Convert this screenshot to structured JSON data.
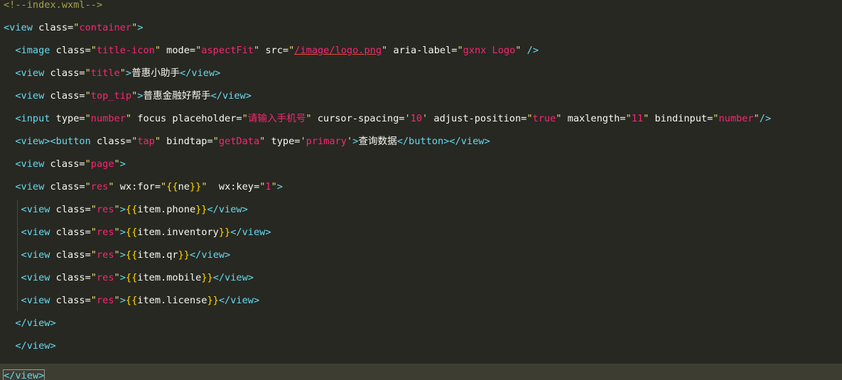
{
  "editor": {
    "language": "wxml",
    "current_line": 16,
    "lines": [
      [
        {
          "t": "<!--index.wxml-->",
          "c": "comment"
        }
      ],
      [
        {
          "t": "<view ",
          "c": "tag"
        },
        {
          "t": "class=",
          "c": "attr"
        },
        {
          "t": "\"",
          "c": "str"
        },
        {
          "t": "container",
          "c": "str-red"
        },
        {
          "t": "\"",
          "c": "str"
        },
        {
          "t": ">",
          "c": "tag"
        }
      ],
      [
        {
          "t": "  <image ",
          "c": "tag"
        },
        {
          "t": "class=",
          "c": "attr"
        },
        {
          "t": "\"",
          "c": "str"
        },
        {
          "t": "title-icon",
          "c": "str-red"
        },
        {
          "t": "\"",
          "c": "str"
        },
        {
          "t": " mode=",
          "c": "attr"
        },
        {
          "t": "\"",
          "c": "str"
        },
        {
          "t": "aspectFit",
          "c": "str-red"
        },
        {
          "t": "\"",
          "c": "str"
        },
        {
          "t": " src=",
          "c": "attr"
        },
        {
          "t": "\"",
          "c": "str"
        },
        {
          "t": "/image/logo.png",
          "c": "str-red",
          "link": true
        },
        {
          "t": "\"",
          "c": "str"
        },
        {
          "t": " aria-label=",
          "c": "attr"
        },
        {
          "t": "\"",
          "c": "str"
        },
        {
          "t": "gxnx Logo",
          "c": "str-red"
        },
        {
          "t": "\"",
          "c": "str"
        },
        {
          "t": " />",
          "c": "tag"
        }
      ],
      [
        {
          "t": "  <view ",
          "c": "tag"
        },
        {
          "t": "class=",
          "c": "attr"
        },
        {
          "t": "\"",
          "c": "str"
        },
        {
          "t": "title",
          "c": "str-red"
        },
        {
          "t": "\"",
          "c": "str"
        },
        {
          "t": ">",
          "c": "tag"
        },
        {
          "t": "普惠小助手",
          "c": "text"
        },
        {
          "t": "</view>",
          "c": "tag"
        }
      ],
      [
        {
          "t": "  <view ",
          "c": "tag"
        },
        {
          "t": "class=",
          "c": "attr"
        },
        {
          "t": "\"",
          "c": "str"
        },
        {
          "t": "top_tip",
          "c": "str-red"
        },
        {
          "t": "\"",
          "c": "str"
        },
        {
          "t": ">",
          "c": "tag"
        },
        {
          "t": "普惠金融好帮手",
          "c": "text"
        },
        {
          "t": "</view>",
          "c": "tag"
        }
      ],
      [
        {
          "t": "  <input ",
          "c": "tag"
        },
        {
          "t": "type=",
          "c": "attr"
        },
        {
          "t": "\"",
          "c": "str"
        },
        {
          "t": "number",
          "c": "str-red"
        },
        {
          "t": "\"",
          "c": "str"
        },
        {
          "t": " focus placeholder=",
          "c": "attr"
        },
        {
          "t": "\"",
          "c": "str"
        },
        {
          "t": "请输入手机号",
          "c": "str-red"
        },
        {
          "t": "\"",
          "c": "str"
        },
        {
          "t": " cursor-spacing=",
          "c": "attr"
        },
        {
          "t": "'",
          "c": "str"
        },
        {
          "t": "10",
          "c": "str-red"
        },
        {
          "t": "'",
          "c": "str"
        },
        {
          "t": " adjust-position=",
          "c": "attr"
        },
        {
          "t": "\"",
          "c": "str"
        },
        {
          "t": "true",
          "c": "str-red"
        },
        {
          "t": "\"",
          "c": "str"
        },
        {
          "t": " maxlength=",
          "c": "attr"
        },
        {
          "t": "\"",
          "c": "str"
        },
        {
          "t": "11",
          "c": "str-red"
        },
        {
          "t": "\"",
          "c": "str"
        },
        {
          "t": " bindinput=",
          "c": "attr"
        },
        {
          "t": "\"",
          "c": "str"
        },
        {
          "t": "number",
          "c": "str-red"
        },
        {
          "t": "\"",
          "c": "str"
        },
        {
          "t": "/>",
          "c": "tag"
        }
      ],
      [
        {
          "t": "  <view><button ",
          "c": "tag"
        },
        {
          "t": "class=",
          "c": "attr"
        },
        {
          "t": "\"",
          "c": "str"
        },
        {
          "t": "tap",
          "c": "str-red"
        },
        {
          "t": "\"",
          "c": "str"
        },
        {
          "t": " bindtap=",
          "c": "attr"
        },
        {
          "t": "\"",
          "c": "str"
        },
        {
          "t": "getData",
          "c": "str-red"
        },
        {
          "t": "\"",
          "c": "str"
        },
        {
          "t": " type=",
          "c": "attr"
        },
        {
          "t": "'",
          "c": "str"
        },
        {
          "t": "primary",
          "c": "str-red"
        },
        {
          "t": "'",
          "c": "str"
        },
        {
          "t": ">",
          "c": "tag"
        },
        {
          "t": "查询数据",
          "c": "text"
        },
        {
          "t": "</button></view>",
          "c": "tag"
        }
      ],
      [
        {
          "t": "  <view ",
          "c": "tag"
        },
        {
          "t": "class=",
          "c": "attr"
        },
        {
          "t": "\"",
          "c": "str"
        },
        {
          "t": "page",
          "c": "str-red"
        },
        {
          "t": "\"",
          "c": "str"
        },
        {
          "t": ">",
          "c": "tag"
        }
      ],
      [
        {
          "t": "  <view ",
          "c": "tag"
        },
        {
          "t": "class=",
          "c": "attr"
        },
        {
          "t": "\"",
          "c": "str"
        },
        {
          "t": "res",
          "c": "str-red"
        },
        {
          "t": "\"",
          "c": "str"
        },
        {
          "t": " wx:for=",
          "c": "attr"
        },
        {
          "t": "\"",
          "c": "str"
        },
        {
          "t": "{{",
          "c": "brace1"
        },
        {
          "t": "ne",
          "c": "text"
        },
        {
          "t": "}}",
          "c": "brace1"
        },
        {
          "t": "\"",
          "c": "str"
        },
        {
          "t": "  wx:key=",
          "c": "attr"
        },
        {
          "t": "\"",
          "c": "str"
        },
        {
          "t": "1",
          "c": "str-red"
        },
        {
          "t": "\"",
          "c": "str"
        },
        {
          "t": ">",
          "c": "tag"
        }
      ],
      [
        {
          "t": "   <view ",
          "c": "tag"
        },
        {
          "t": "class=",
          "c": "attr"
        },
        {
          "t": "\"",
          "c": "str"
        },
        {
          "t": "res",
          "c": "str-red"
        },
        {
          "t": "\"",
          "c": "str"
        },
        {
          "t": ">",
          "c": "tag"
        },
        {
          "t": "{{",
          "c": "brace1"
        },
        {
          "t": "item.phone",
          "c": "text"
        },
        {
          "t": "}}",
          "c": "brace1"
        },
        {
          "t": "</view>",
          "c": "tag"
        }
      ],
      [
        {
          "t": "   <view ",
          "c": "tag"
        },
        {
          "t": "class=",
          "c": "attr"
        },
        {
          "t": "\"",
          "c": "str"
        },
        {
          "t": "res",
          "c": "str-red"
        },
        {
          "t": "\"",
          "c": "str"
        },
        {
          "t": ">",
          "c": "tag"
        },
        {
          "t": "{{",
          "c": "brace1"
        },
        {
          "t": "item.inventory",
          "c": "text"
        },
        {
          "t": "}}",
          "c": "brace1"
        },
        {
          "t": "</view>",
          "c": "tag"
        }
      ],
      [
        {
          "t": "   <view ",
          "c": "tag"
        },
        {
          "t": "class=",
          "c": "attr"
        },
        {
          "t": "\"",
          "c": "str"
        },
        {
          "t": "res",
          "c": "str-red"
        },
        {
          "t": "\"",
          "c": "str"
        },
        {
          "t": ">",
          "c": "tag"
        },
        {
          "t": "{{",
          "c": "brace1"
        },
        {
          "t": "item.qr",
          "c": "text"
        },
        {
          "t": "}}",
          "c": "brace1"
        },
        {
          "t": "</view>",
          "c": "tag"
        }
      ],
      [
        {
          "t": "   <view ",
          "c": "tag"
        },
        {
          "t": "class=",
          "c": "attr"
        },
        {
          "t": "\"",
          "c": "str"
        },
        {
          "t": "res",
          "c": "str-red"
        },
        {
          "t": "\"",
          "c": "str"
        },
        {
          "t": ">",
          "c": "tag"
        },
        {
          "t": "{{",
          "c": "brace1"
        },
        {
          "t": "item.mobile",
          "c": "text"
        },
        {
          "t": "}}",
          "c": "brace1"
        },
        {
          "t": "</view>",
          "c": "tag"
        }
      ],
      [
        {
          "t": "   <view ",
          "c": "tag"
        },
        {
          "t": "class=",
          "c": "attr"
        },
        {
          "t": "\"",
          "c": "str"
        },
        {
          "t": "res",
          "c": "str-red"
        },
        {
          "t": "\"",
          "c": "str"
        },
        {
          "t": ">",
          "c": "tag"
        },
        {
          "t": "{{",
          "c": "brace1"
        },
        {
          "t": "item.license",
          "c": "text"
        },
        {
          "t": "}}",
          "c": "brace1"
        },
        {
          "t": "</view>",
          "c": "tag"
        }
      ],
      [
        {
          "t": "  </view>",
          "c": "tag"
        }
      ],
      [
        {
          "t": "  </view>",
          "c": "tag"
        }
      ],
      [
        {
          "t": "</view>",
          "c": "tag",
          "match": true
        }
      ]
    ]
  },
  "colors": {
    "background": "#272822",
    "current_line": "#3e3d32",
    "tag": "#66d9ef",
    "string": "#e6db74",
    "string_value": "#f92672",
    "comment": "#a6a14a",
    "brace": "#ffd700"
  }
}
